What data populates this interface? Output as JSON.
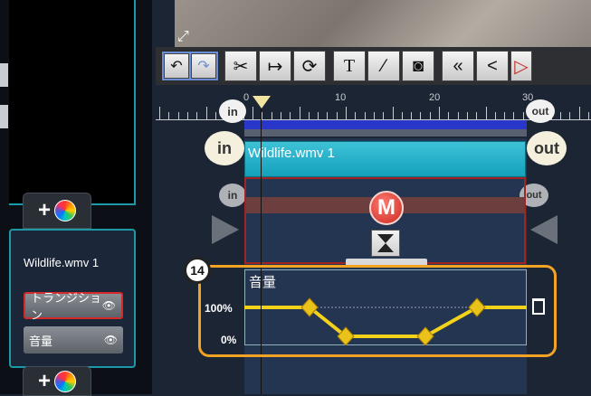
{
  "left_panel": {
    "add_effect_label": "+",
    "clip_name": "Wildlife.wmv 1",
    "buttons": [
      {
        "label": "トランジション",
        "icon": "eye-icon"
      },
      {
        "label": "音量",
        "icon": "eye-icon"
      }
    ]
  },
  "toolbar": {
    "buttons": [
      {
        "name": "undo-button",
        "glyph": "↶"
      },
      {
        "name": "redo-button",
        "glyph": "↷"
      },
      {
        "name": "scissors-button",
        "glyph": "✂"
      },
      {
        "name": "trim-end-button",
        "glyph": "↦"
      },
      {
        "name": "lasso-button",
        "glyph": "⟳"
      },
      {
        "name": "text-button",
        "glyph": "T"
      },
      {
        "name": "pen-button",
        "glyph": "∕"
      },
      {
        "name": "snapshot-button",
        "glyph": "◙"
      },
      {
        "name": "rewind-button",
        "glyph": "«"
      },
      {
        "name": "prev-button",
        "glyph": "<"
      },
      {
        "name": "play-button",
        "glyph": "▷"
      }
    ]
  },
  "ruler": {
    "labels": [
      "0",
      "10",
      "20",
      "30"
    ],
    "in_label": "in",
    "out_label": "out"
  },
  "timeline": {
    "clip_label": "Wildlife.wmv 1",
    "in_label": "in",
    "out_label": "out",
    "transition_badge": "M"
  },
  "volume": {
    "title": "音量",
    "label_100": "100%",
    "label_0": "0%",
    "envelope_percent": [
      100,
      100,
      0,
      0,
      100,
      100
    ]
  },
  "callout": {
    "number": "14"
  },
  "colors": {
    "accent_cyan": "#1d9aa8",
    "callout_orange": "#f2a323",
    "envelope_yellow": "#f4d21a",
    "clip_bar": "#14a0bb",
    "transition_red": "#a02424"
  }
}
